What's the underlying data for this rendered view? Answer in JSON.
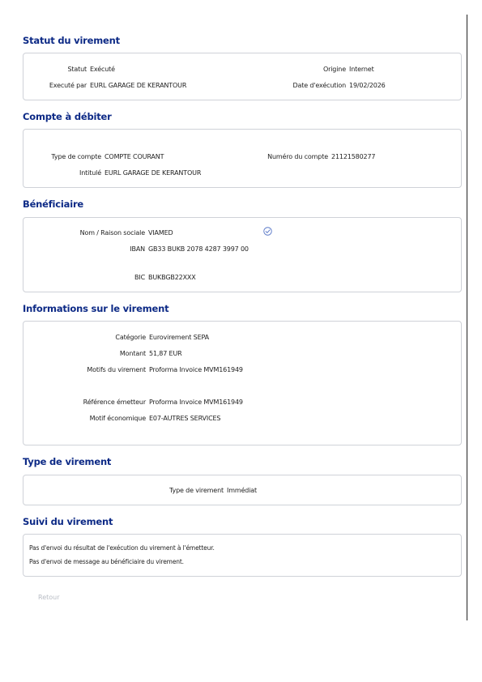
{
  "statut": {
    "title": "Statut du virement",
    "statut_label": "Statut",
    "statut_value": "Exécuté",
    "origine_label": "Origine",
    "origine_value": "Internet",
    "execute_par_label": "Executé par",
    "execute_par_value": "EURL GARAGE DE KERANTOUR",
    "date_label": "Date d'exécution",
    "date_value": "19/02/2026"
  },
  "compte": {
    "title": "Compte à débiter",
    "type_label": "Type de compte",
    "type_value": "COMPTE COURANT",
    "numero_label": "Numéro du compte",
    "numero_value": "21121580277",
    "intitule_label": "Intitulé",
    "intitule_value": "EURL GARAGE DE KERANTOUR"
  },
  "beneficiaire": {
    "title": "Bénéficiaire",
    "nom_label": "Nom / Raison sociale",
    "nom_value": "VIAMED",
    "iban_label": "IBAN",
    "iban_value": "GB33 BUKB 2078 4287 3997 00",
    "bic_label": "BIC",
    "bic_value": "BUKBGB22XXX",
    "verified_icon": "check-circle-icon"
  },
  "informations": {
    "title": "Informations sur le virement",
    "categorie_label": "Catégorie",
    "categorie_value": "Eurovirement SEPA",
    "montant_label": "Montant",
    "montant_value": "51,87 EUR",
    "motifs_label": "Motifs du virement",
    "motifs_value": "Proforma Invoice MVM161949",
    "reference_label": "Référence émetteur",
    "reference_value": "Proforma Invoice MVM161949",
    "motif_eco_label": "Motif économique",
    "motif_eco_value": "E07-AUTRES SERVICES"
  },
  "type_virement": {
    "title": "Type de virement",
    "type_label": "Type de virement",
    "type_value": "Immédiat"
  },
  "suivi": {
    "title": "Suivi du virement",
    "line1": "Pas d'envoi du résultat de l'exécution du virement à l'émetteur.",
    "line2": "Pas d'envoi de message au bénéficiaire du virement."
  },
  "footer": {
    "retour_label": "Retour"
  },
  "colors": {
    "title": "#0d2a86",
    "border": "#cfd2d8",
    "icon": "#5b79c8",
    "retour": "#b8bcc4"
  }
}
